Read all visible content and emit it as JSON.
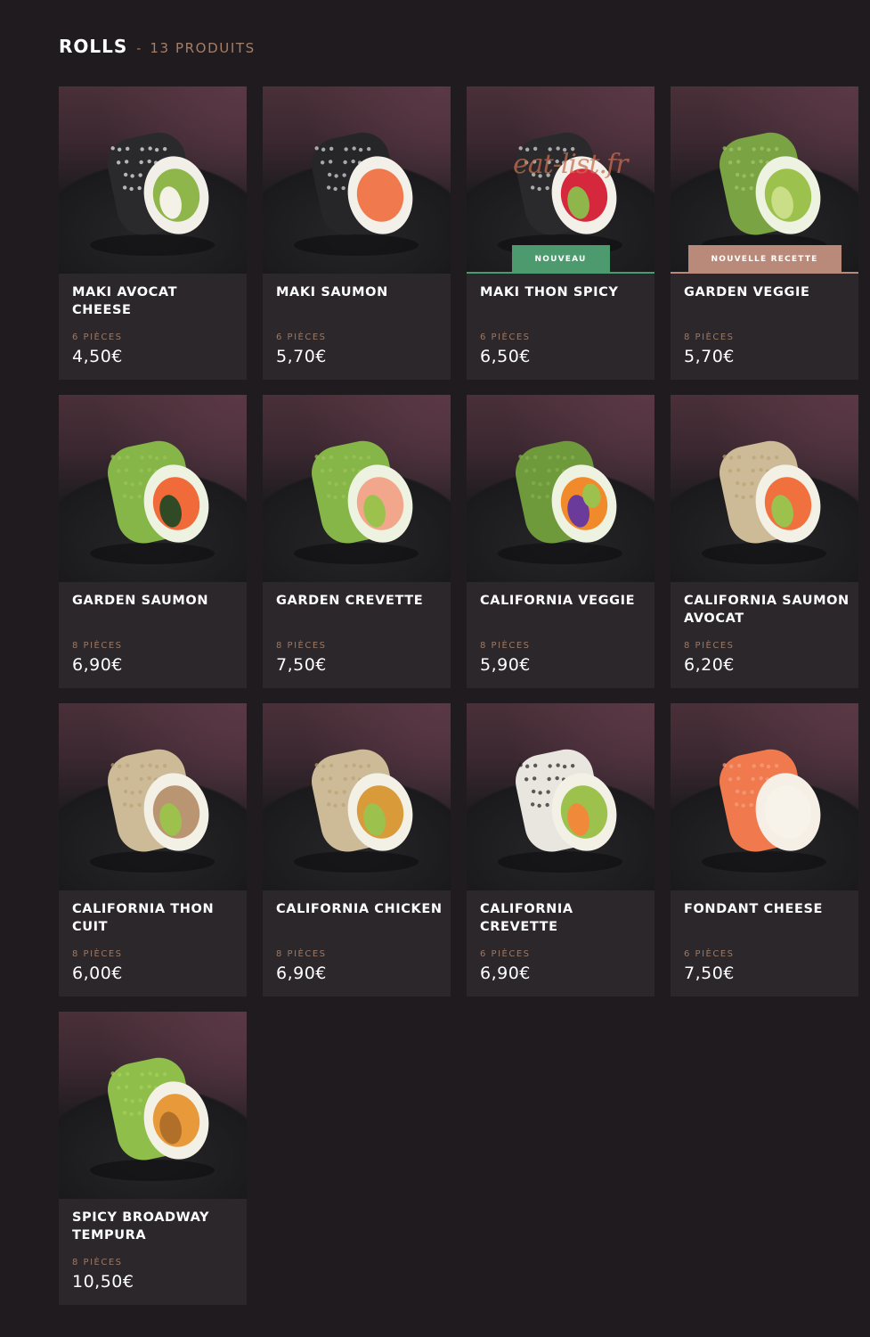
{
  "header": {
    "title": "ROLLS",
    "separator": "-",
    "count": "13 PRODUITS"
  },
  "colors": {
    "background": "#1f1b1e",
    "card": "#2b272a",
    "accent": "#a77e68",
    "badge_new": "#4d9a6e",
    "badge_recipe": "#b98a79"
  },
  "products": [
    {
      "name": "MAKI AVOCAT CHEESE",
      "pieces": "6 PIÈCES",
      "price": "4,50€",
      "badge": "",
      "roll": "nori-avocado"
    },
    {
      "name": "MAKI SAUMON",
      "pieces": "6 PIÈCES",
      "price": "5,70€",
      "badge": "",
      "roll": "nori-salmon"
    },
    {
      "name": "MAKI THON SPICY",
      "pieces": "6 PIÈCES",
      "price": "6,50€",
      "badge": "NOUVEAU",
      "badge_style": "green",
      "watermark": "eat-list.fr",
      "roll": "nori-tuna"
    },
    {
      "name": "GARDEN VEGGIE",
      "pieces": "8 PIÈCES",
      "price": "5,70€",
      "badge": "NOUVELLE RECETTE",
      "badge_style": "rose",
      "roll": "garden-veggie"
    },
    {
      "name": "GARDEN SAUMON",
      "pieces": "8 PIÈCES",
      "price": "6,90€",
      "badge": "",
      "roll": "garden-salmon"
    },
    {
      "name": "GARDEN CREVETTE",
      "pieces": "8 PIÈCES",
      "price": "7,50€",
      "badge": "",
      "roll": "garden-shrimp"
    },
    {
      "name": "CALIFORNIA VEGGIE",
      "pieces": "8 PIÈCES",
      "price": "5,90€",
      "badge": "",
      "roll": "california-veggie"
    },
    {
      "name": "CALIFORNIA SAUMON AVOCAT",
      "pieces": "8 PIÈCES",
      "price": "6,20€",
      "badge": "",
      "roll": "california-salmon"
    },
    {
      "name": "CALIFORNIA THON CUIT",
      "pieces": "8 PIÈCES",
      "price": "6,00€",
      "badge": "",
      "roll": "california-tuna"
    },
    {
      "name": "CALIFORNIA CHICKEN",
      "pieces": "8 PIÈCES",
      "price": "6,90€",
      "badge": "",
      "roll": "california-chicken"
    },
    {
      "name": "CALIFORNIA CREVETTE",
      "pieces": "6 PIÈCES",
      "price": "6,90€",
      "badge": "",
      "roll": "california-shrimp"
    },
    {
      "name": "FONDANT CHEESE",
      "pieces": "6 PIÈCES",
      "price": "7,50€",
      "badge": "",
      "roll": "fondant-cheese"
    },
    {
      "name": "SPICY BROADWAY TEMPURA",
      "pieces": "8 PIÈCES",
      "price": "10,50€",
      "badge": "",
      "roll": "spicy-broadway"
    }
  ]
}
